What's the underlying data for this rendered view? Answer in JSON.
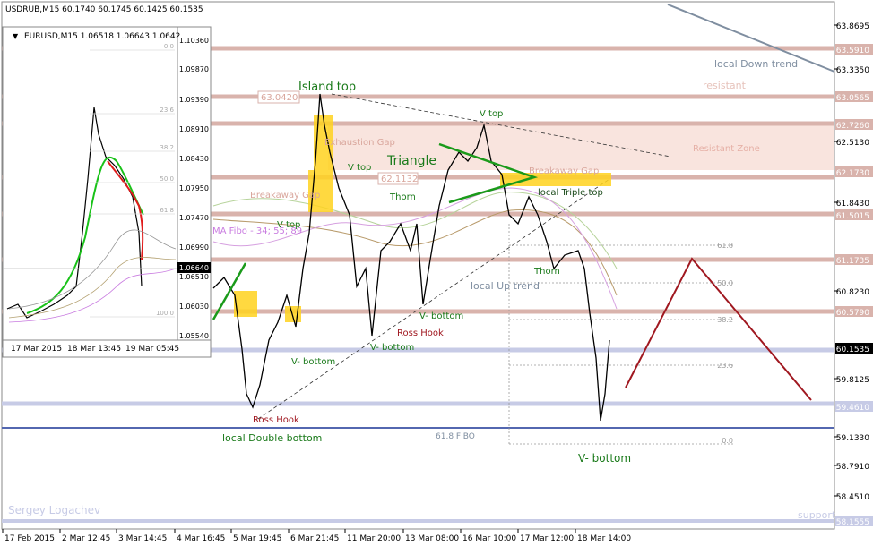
{
  "main": {
    "header": "USDRUB,M15  60.1740 60.1745 60.1425 60.1535",
    "price_labels": [
      "63.8695",
      "63.5910",
      "63.3350",
      "63.0565",
      "62.7260",
      "62.5130",
      "62.1730",
      "61.8430",
      "61.5015",
      "61.1735",
      "60.8230",
      "60.5790",
      "60.1535",
      "59.8125",
      "59.4610",
      "59.1330",
      "58.7910",
      "58.4510",
      "58.1555"
    ],
    "date_labels": [
      "17 Feb 2015",
      "2 Mar 12:45",
      "3 Mar 14:45",
      "4 Mar 16:45",
      "5 Mar 19:45",
      "6 Mar 21:45",
      "11 Mar 20:00",
      "13 Mar 08:00",
      "16 Mar 10:00",
      "17 Mar 12:00",
      "18 Mar 14:00"
    ],
    "annotations": {
      "island_top": "Island top",
      "triangle": "Triangle",
      "v_top_1": "V top",
      "v_top_2": "V top",
      "v_top_3": "V top",
      "thorn_1": "Thorn",
      "thorn_2": "Thorn",
      "exhaustion_gap": "Exhaustion Gap",
      "breakaway_gap_1": "Breakaway Gap",
      "breakaway_gap_2": "Breakaway Gap",
      "local_triple_top": "local Triple top",
      "local_up_trend": "local Up trend",
      "local_down_trend": "local Down trend",
      "resistant": "resistant",
      "resistant_zone": "Resistant Zone",
      "v_bottom_1": "V- bottom",
      "v_bottom_2": "V- bottom",
      "v_bottom_3": "V- bottom",
      "v_bottom_4": "V- bottom",
      "ross_hook_1": "Ross Hook",
      "ross_hook_2": "Ross Hook",
      "local_double_bottom": "local Double bottom",
      "fibo_618": "61.8 FIBO",
      "ma_label": "MA Fibo - 34; 55; 89",
      "price_tag_1": "63.0420",
      "price_tag_2": "62.1132",
      "support": "support",
      "author": "Sergey Logachev"
    },
    "fib_levels": [
      "61.8",
      "50.0",
      "38.2",
      "23.6",
      "0.0"
    ]
  },
  "inset": {
    "header": "EURUSD,M15  1.06518 1.06643 1.0642",
    "price_labels": [
      "1.10360",
      "1.09870",
      "1.09390",
      "1.08910",
      "1.08430",
      "1.07950",
      "1.07470",
      "1.06990",
      "1.06510",
      "1.06030",
      "1.05540"
    ],
    "current_price": "1.06640",
    "date_labels": [
      "17 Mar 2015",
      "18 Mar 13:45",
      "19 Mar 05:45"
    ],
    "fib_levels": [
      "0.0",
      "23.6",
      "38.2",
      "50.0",
      "61.8",
      "100.0"
    ]
  },
  "chart_data": [
    {
      "type": "line",
      "title": "USDRUB,M15",
      "ylim": [
        58.1555,
        63.8695
      ],
      "series": [
        {
          "name": "USDRUB",
          "x": [
            "17 Feb 2015",
            "2 Mar 12:45",
            "3 Mar 14:45",
            "4 Mar 16:45",
            "5 Mar 19:45",
            "6 Mar 21:45",
            "11 Mar 20:00",
            "13 Mar 08:00",
            "16 Mar 10:00",
            "17 Mar 12:00",
            "18 Mar 14:00"
          ],
          "values": [
            60.75,
            60.25,
            59.6,
            60.45,
            59.2,
            62.95,
            61.05,
            61.4,
            62.4,
            61.05,
            59.15
          ]
        }
      ],
      "horizontal_levels": [
        63.591,
        63.0565,
        62.726,
        62.173,
        61.6315,
        61.1735,
        60.579,
        60.1535,
        59.461,
        59.133,
        58.1555
      ],
      "fibonacci": {
        "levels": [
          "61.8",
          "50.0",
          "38.2",
          "23.6",
          "0.0"
        ]
      }
    },
    {
      "type": "line",
      "title": "EURUSD,M15",
      "ylim": [
        1.0554,
        1.1036
      ],
      "series": [
        {
          "name": "EURUSD",
          "x": [
            "17 Mar 2015",
            "18 Mar 13:45",
            "19 Mar 05:45"
          ],
          "values": [
            1.059,
            1.096,
            1.0664
          ]
        }
      ],
      "fibonacci": {
        "levels": [
          "0.0",
          "23.6",
          "38.2",
          "50.0",
          "61.8",
          "100.0"
        ]
      }
    }
  ]
}
